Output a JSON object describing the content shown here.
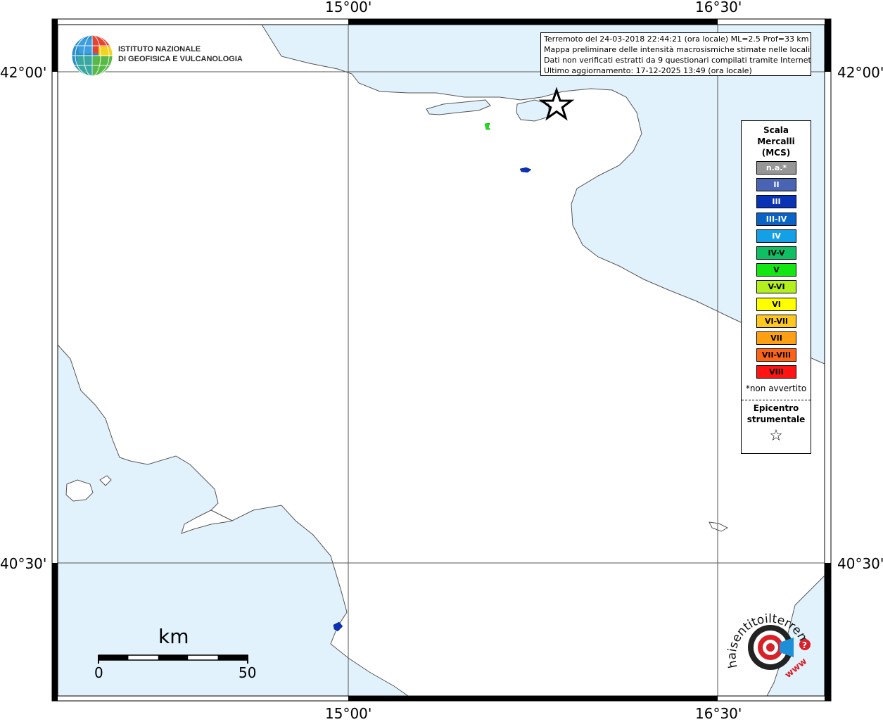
{
  "map": {
    "longitude_labels": [
      "15°00'",
      "16°30'"
    ],
    "latitude_labels": [
      "42°00'",
      "40°30'"
    ]
  },
  "colors": {
    "sea": "#e2f2fc",
    "land": "#ffffff",
    "coastline": "#555555",
    "frame": "#000000"
  },
  "ingv_logo": {
    "line1": "ISTITUTO NAZIONALE",
    "line2": "DI GEOFISICA E VULCANOLOGIA"
  },
  "info": {
    "line1": "Terremoto del 24-03-2018 22:44:21 (ora locale) ML=2.5 Prof=33 km",
    "line2": "Mappa preliminare delle intensità macrosismiche stimate nelle località",
    "line3": "Dati non verificati estratti da 9 questionari compilati tramite Internet.",
    "line4": "Ultimo aggiornamento: 17-12-2025 13:49 (ora locale)"
  },
  "legend": {
    "title_line1": "Scala",
    "title_line2": "Mercalli",
    "title_line3": "(MCS)",
    "items": [
      {
        "label": "n.a.*",
        "color": "#969696",
        "dark_text": false
      },
      {
        "label": "II",
        "color": "#4a64b4",
        "dark_text": false
      },
      {
        "label": "III",
        "color": "#0a32b4",
        "dark_text": false
      },
      {
        "label": "III-IV",
        "color": "#0a64c8",
        "dark_text": false
      },
      {
        "label": "IV",
        "color": "#14a0e6",
        "dark_text": false
      },
      {
        "label": "IV-V",
        "color": "#10be64",
        "dark_text": true
      },
      {
        "label": "V",
        "color": "#14e614",
        "dark_text": true
      },
      {
        "label": "V-VI",
        "color": "#b4f01e",
        "dark_text": true
      },
      {
        "label": "VI",
        "color": "#ffff00",
        "dark_text": true
      },
      {
        "label": "VI-VII",
        "color": "#ffc81e",
        "dark_text": true
      },
      {
        "label": "VII",
        "color": "#ffa014",
        "dark_text": true
      },
      {
        "label": "VII-VIII",
        "color": "#ff6414",
        "dark_text": true
      },
      {
        "label": "VIII",
        "color": "#ff1414",
        "dark_text": true
      }
    ],
    "note": "*non avvertito",
    "epicenter_line1": "Epicentro",
    "epicenter_line2": "strumentale"
  },
  "scalebar": {
    "unit": "km",
    "min_label": "0",
    "max_label": "50"
  },
  "intensity_points": [
    {
      "name": "point-green",
      "color": "#14e614"
    },
    {
      "name": "point-blue-east",
      "color": "#0a32b4"
    },
    {
      "name": "point-blue-west",
      "color": "#0a32b4"
    }
  ],
  "hsl_logo": {
    "text": "haisentitoilterremoto.it",
    "www": "www"
  }
}
